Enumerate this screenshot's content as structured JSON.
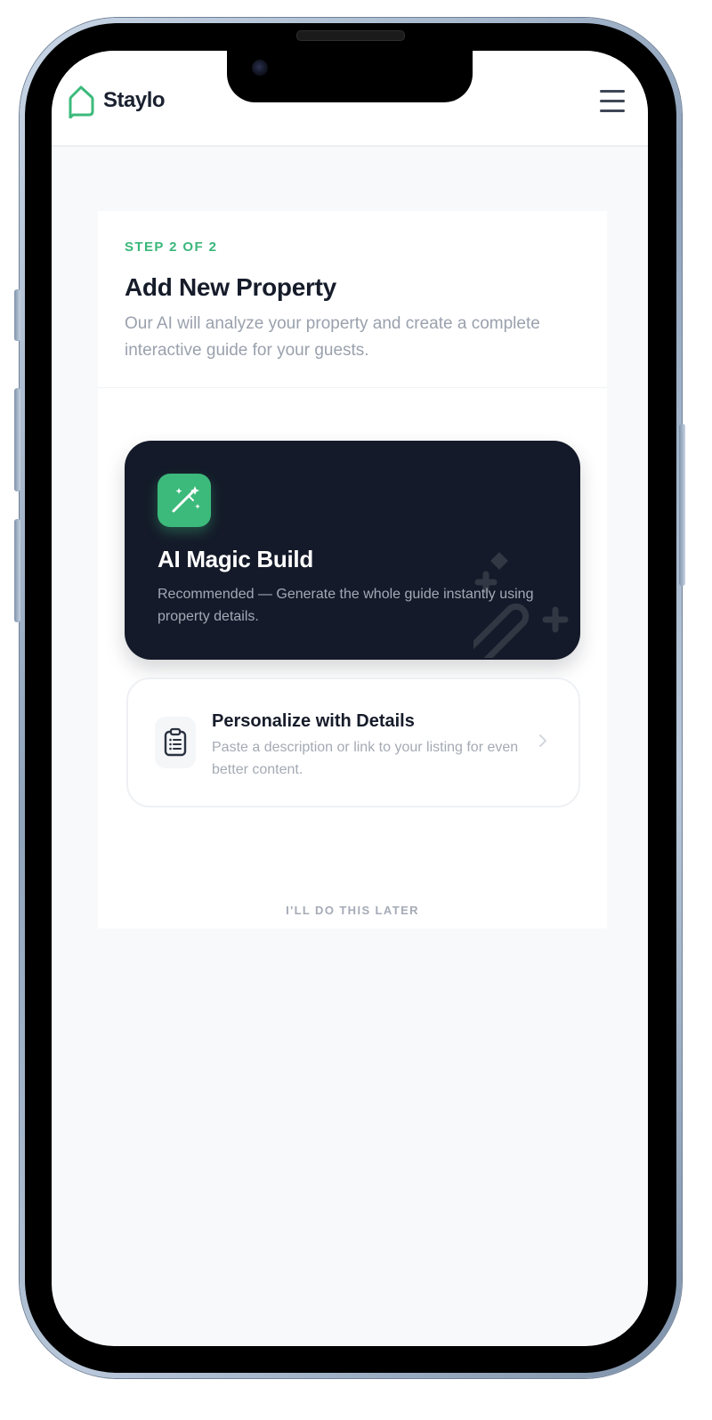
{
  "app": {
    "brand": "Staylo",
    "accent_color": "#3cba7b",
    "menu_icon": "hamburger-menu-icon"
  },
  "onboarding": {
    "step_label": "STEP 2 OF 2",
    "title": "Add New Property",
    "subtitle": "Our AI will analyze your property and create a complete interactive guide for your guests."
  },
  "options": {
    "magic_build": {
      "title": "AI Magic Build",
      "description": "Recommended — Generate the whole guide instantly using property details.",
      "icon": "magic-wand-icon"
    },
    "personalize": {
      "title": "Personalize with Details",
      "description": "Paste a description or link to your listing for even better content.",
      "icon": "clipboard-list-icon"
    }
  },
  "actions": {
    "later_label": "I'LL DO THIS LATER"
  }
}
